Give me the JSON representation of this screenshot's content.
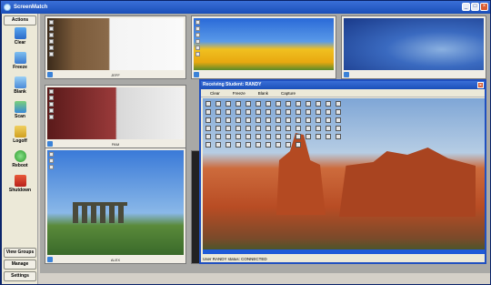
{
  "window": {
    "title": "ScreenMatch"
  },
  "sidebar": {
    "actions_header": "Actions",
    "actions": [
      {
        "label": "Clear",
        "icon": "clear-icon"
      },
      {
        "label": "Freeze",
        "icon": "freeze-icon"
      },
      {
        "label": "Blank",
        "icon": "blank-icon"
      },
      {
        "label": "Scan",
        "icon": "scan-icon"
      },
      {
        "label": "Logoff",
        "icon": "logoff-icon"
      },
      {
        "label": "Reboot",
        "icon": "reboot-icon"
      },
      {
        "label": "Shutdown",
        "icon": "shutdown-icon"
      }
    ],
    "view_groups": "View Groups",
    "manage": "Manage",
    "settings": "Settings"
  },
  "thumbnails": [
    {
      "name": "JEFF"
    },
    {
      "name": ""
    },
    {
      "name": ""
    },
    {
      "name": "PAM"
    },
    {
      "name": "ALEX"
    }
  ],
  "popup": {
    "title": "Receiving Student: RANDY",
    "menu": [
      "Clear",
      "Freeze",
      "Blank",
      "Capture"
    ],
    "status": "User RANDY status: CONNECTED"
  },
  "colors": {
    "titlebar": "#1a4fb8",
    "sidebar": "#ece9d8",
    "main": "#a9a9a6"
  }
}
